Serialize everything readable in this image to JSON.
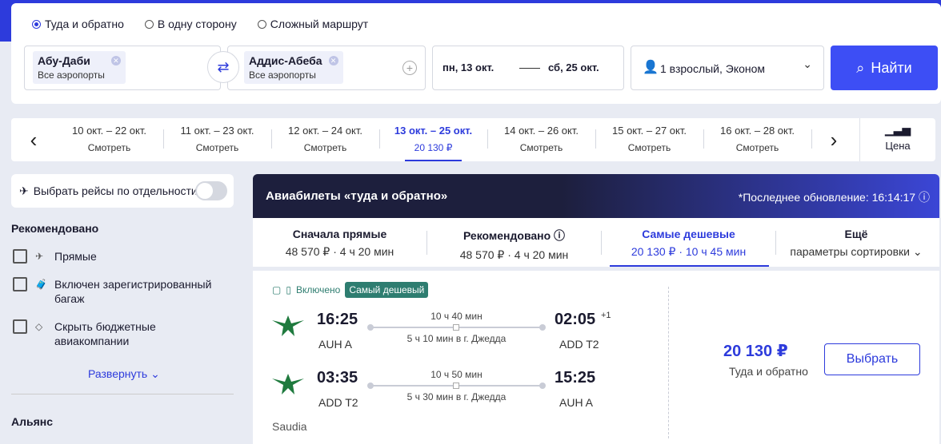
{
  "search": {
    "trip_types": [
      {
        "label": "Туда и обратно",
        "selected": true
      },
      {
        "label": "В одну сторону",
        "selected": false
      },
      {
        "label": "Сложный маршрут",
        "selected": false
      }
    ],
    "origin": {
      "city": "Абу-Даби",
      "sub": "Все аэропорты"
    },
    "destination": {
      "city": "Аддис-Абеба",
      "sub": "Все аэропорты"
    },
    "date_from": "пн, 13 окт.",
    "date_to": "сб, 25 окт.",
    "passengers": "1 взрослый, Эконом",
    "find_label": "Найти",
    "accent_color": "#3d4ef5"
  },
  "datebar": {
    "cells": [
      {
        "range": "10 окт. – 22 окт.",
        "price": "Смотреть",
        "selected": false
      },
      {
        "range": "11 окт. – 23 окт.",
        "price": "Смотреть",
        "selected": false
      },
      {
        "range": "12 окт. – 24 окт.",
        "price": "Смотреть",
        "selected": false
      },
      {
        "range": "13 окт. – 25 окт.",
        "price": "20 130 ₽",
        "selected": true
      },
      {
        "range": "14 окт. – 26 окт.",
        "price": "Смотреть",
        "selected": false
      },
      {
        "range": "15 окт. – 27 окт.",
        "price": "Смотреть",
        "selected": false
      },
      {
        "range": "16 окт. – 28 окт.",
        "price": "Смотреть",
        "selected": false
      }
    ],
    "price_chart_label": "Цена"
  },
  "sidebar": {
    "toggle_label": "Выбрать рейсы по отдельности",
    "section_recommended": "Рекомендовано",
    "filters": [
      {
        "label": "Прямые",
        "icon": "direct-flight-icon"
      },
      {
        "label": "Включен зарегистрированный багаж",
        "icon": "luggage-icon"
      },
      {
        "label": "Скрыть бюджетные авиакомпании",
        "icon": "tag-icon"
      }
    ],
    "expand_label": "Развернуть",
    "section_alliance": "Альянс"
  },
  "results": {
    "header_title": "Авиабилеты «туда и обратно»",
    "last_update": "*Последнее обновление: 16:14:17",
    "sort_tabs": [
      {
        "title": "Сначала прямые",
        "sub": "48 570 ₽ · 4 ч 20 мин",
        "selected": false
      },
      {
        "title": "Рекомендовано",
        "sub": "48 570 ₽ · 4 ч 20 мин",
        "selected": false
      },
      {
        "title": "Самые дешевые",
        "sub": "20 130 ₽ · 10 ч 45 мин",
        "selected": true
      },
      {
        "title": "Ещё",
        "sub": "параметры сортировки",
        "selected": false
      }
    ],
    "ticket": {
      "included_label": "Включено",
      "cheapest_badge": "Самый дешевый",
      "legs": [
        {
          "dep_time": "16:25",
          "dep_airport": "AUH A",
          "duration": "10 ч 40 мин",
          "stop": "5 ч 10 мин в г. Джедда",
          "arr_time": "02:05",
          "arr_airport": "ADD T2",
          "day_shift": "+1"
        },
        {
          "dep_time": "03:35",
          "dep_airport": "ADD T2",
          "duration": "10 ч 50 мин",
          "stop": "5 ч 30 мин в г. Джедда",
          "arr_time": "15:25",
          "arr_airport": "AUH A",
          "day_shift": ""
        }
      ],
      "carrier": "Saudia",
      "price": "20 130 ₽",
      "price_sub": "Туда и обратно",
      "select_label": "Выбрать"
    }
  }
}
